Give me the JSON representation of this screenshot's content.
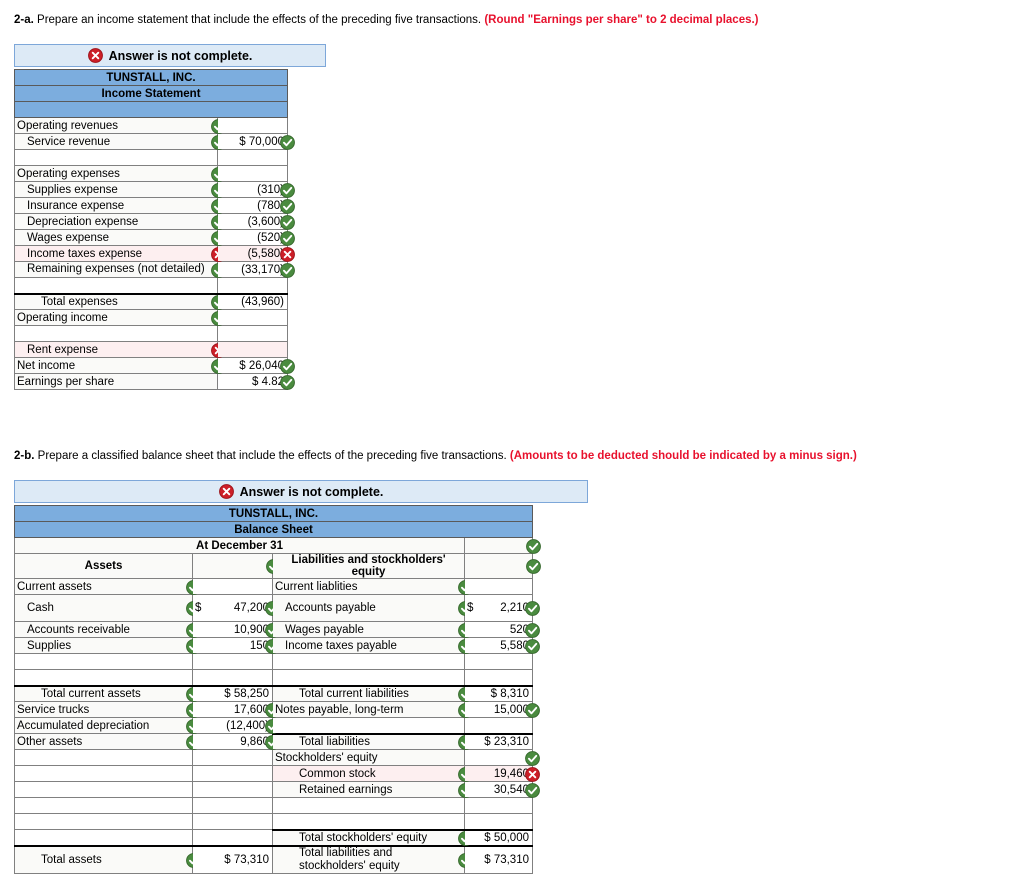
{
  "q2a": {
    "number": "2-a.",
    "text": "Prepare an income statement that include the effects of the preceding five transactions.",
    "hint": "(Round \"Earnings per share\" to 2 decimal places.)",
    "banner": "Answer is not complete.",
    "banner_icon": "x-circle-icon",
    "title1": "TUNSTALL, INC.",
    "title2": "Income Statement",
    "rows": [
      {
        "label": "Operating revenues",
        "indent": 0,
        "label_mark": "check",
        "value": "",
        "value_mark": "",
        "state": "ok"
      },
      {
        "label": "Service revenue",
        "indent": 1,
        "label_mark": "check",
        "value": "$ 70,000",
        "value_mark": "check",
        "state": "ok",
        "dollar": true
      },
      {
        "label": "",
        "indent": 0,
        "label_mark": "",
        "value": "",
        "value_mark": "",
        "state": "blank"
      },
      {
        "label": "Operating expenses",
        "indent": 0,
        "label_mark": "check",
        "value": "",
        "value_mark": "",
        "state": "ok"
      },
      {
        "label": "Supplies expense",
        "indent": 1,
        "label_mark": "check",
        "value": "(310)",
        "value_mark": "check",
        "state": "ok"
      },
      {
        "label": "Insurance expense",
        "indent": 1,
        "label_mark": "check",
        "value": "(780)",
        "value_mark": "check",
        "state": "ok"
      },
      {
        "label": "Depreciation expense",
        "indent": 1,
        "label_mark": "check",
        "value": "(3,600)",
        "value_mark": "check",
        "state": "ok"
      },
      {
        "label": "Wages expense",
        "indent": 1,
        "label_mark": "check",
        "value": "(520)",
        "value_mark": "check",
        "state": "ok"
      },
      {
        "label": "Income taxes expense",
        "indent": 1,
        "label_mark": "x",
        "value": "(5,580)",
        "value_mark": "x",
        "state": "err"
      },
      {
        "label": "Remaining expenses (not detailed)",
        "indent": 1,
        "label_mark": "check",
        "value": "(33,170)",
        "value_mark": "check",
        "state": "ok",
        "wrap": true
      },
      {
        "label": "",
        "indent": 0,
        "label_mark": "",
        "value": "",
        "value_mark": "",
        "state": "blank"
      },
      {
        "label": "Total expenses",
        "indent": 2,
        "label_mark": "check",
        "value": "(43,960)",
        "value_mark": "",
        "state": "ok",
        "topline": true
      },
      {
        "label": "Operating income",
        "indent": 0,
        "label_mark": "check",
        "value": "",
        "value_mark": "",
        "state": "ok"
      },
      {
        "label": "",
        "indent": 0,
        "label_mark": "",
        "value": "",
        "value_mark": "",
        "state": "blank"
      },
      {
        "label": "Rent expense",
        "indent": 1,
        "label_mark": "x",
        "value": "",
        "value_mark": "",
        "state": "err"
      },
      {
        "label": "Net income",
        "indent": 0,
        "label_mark": "check",
        "value": "$ 26,040",
        "value_mark": "check",
        "state": "ok",
        "dollar": true
      },
      {
        "label": "Earnings per share",
        "indent": 0,
        "label_mark": "",
        "value": "$     4.82",
        "value_mark": "check",
        "state": "ok",
        "dollar": true
      }
    ]
  },
  "q2b": {
    "number": "2-b.",
    "text": "Prepare a classified balance sheet that include the effects of the preceding five transactions.",
    "hint": "(Amounts to be deducted should be indicated by a minus sign.)",
    "banner": "Answer is not complete.",
    "banner_icon": "x-circle-icon",
    "title1": "TUNSTALL, INC.",
    "title2": "Balance Sheet",
    "title3": "At December 31",
    "title3_mark": "check",
    "col_head_left": "Assets",
    "col_head_left_mark": "check",
    "col_head_right": "Liabilities and stockholders' equity",
    "col_head_right_mark": "check",
    "rows": [
      {
        "left": {
          "label": "Current assets",
          "indent": 0,
          "mark": "check",
          "value": "",
          "vmark": "",
          "state": "ok"
        },
        "right": {
          "label": "Current liablities",
          "indent": 0,
          "mark": "check",
          "value": "",
          "vmark": "",
          "state": "ok"
        }
      },
      {
        "left": {
          "label": "Cash",
          "indent": 1,
          "mark": "check",
          "value": "47,200",
          "dollar": "$",
          "vmark": "check",
          "state": "ok",
          "tall": true
        },
        "right": {
          "label": "Accounts payable",
          "indent": 1,
          "mark": "check",
          "value": "2,210",
          "dollar": "$",
          "vmark": "check",
          "state": "ok",
          "tall": true
        }
      },
      {
        "left": {
          "label": "Accounts receivable",
          "indent": 1,
          "mark": "check",
          "value": "10,900",
          "vmark": "check",
          "state": "ok"
        },
        "right": {
          "label": "Wages payable",
          "indent": 1,
          "mark": "check",
          "value": "520",
          "vmark": "check",
          "state": "ok"
        }
      },
      {
        "left": {
          "label": "Supplies",
          "indent": 1,
          "mark": "check",
          "value": "150",
          "vmark": "check",
          "state": "ok"
        },
        "right": {
          "label": "Income taxes payable",
          "indent": 1,
          "mark": "check",
          "value": "5,580",
          "vmark": "check",
          "state": "ok"
        }
      },
      {
        "left": {
          "label": "",
          "indent": 0,
          "mark": "",
          "value": "",
          "vmark": "",
          "state": "blank"
        },
        "right": {
          "label": "",
          "indent": 0,
          "mark": "",
          "value": "",
          "vmark": "",
          "state": "blank"
        }
      },
      {
        "left": {
          "label": "",
          "indent": 0,
          "mark": "",
          "value": "",
          "vmark": "",
          "state": "blank"
        },
        "right": {
          "label": "",
          "indent": 0,
          "mark": "",
          "value": "",
          "vmark": "",
          "state": "blank"
        }
      },
      {
        "left": {
          "label": "Total current assets",
          "indent": 2,
          "mark": "check",
          "value": "$   58,250",
          "vmark": "",
          "state": "ok",
          "topline": true
        },
        "right": {
          "label": "Total current liabilities",
          "indent": 2,
          "mark": "check",
          "value": "$   8,310",
          "vmark": "",
          "state": "ok",
          "topline": true
        }
      },
      {
        "left": {
          "label": "Service trucks",
          "indent": 0,
          "mark": "check",
          "value": "17,600",
          "vmark": "check",
          "state": "ok"
        },
        "right": {
          "label": "Notes payable, long-term",
          "indent": 0,
          "mark": "check",
          "value": "15,000",
          "vmark": "check",
          "state": "ok"
        }
      },
      {
        "left": {
          "label": "Accumulated depreciation",
          "indent": 0,
          "mark": "check",
          "value": "(12,400)",
          "vmark": "check",
          "state": "ok"
        },
        "right": {
          "label": "",
          "indent": 0,
          "mark": "",
          "value": "",
          "vmark": "",
          "state": "blank"
        }
      },
      {
        "left": {
          "label": "Other assets",
          "indent": 0,
          "mark": "check",
          "value": "9,860",
          "vmark": "check",
          "state": "ok"
        },
        "right": {
          "label": "Total liabilities",
          "indent": 2,
          "mark": "check",
          "value": "$ 23,310",
          "vmark": "",
          "state": "ok",
          "topline": true
        }
      },
      {
        "left": {
          "label": "",
          "indent": 0,
          "mark": "",
          "value": "",
          "vmark": "",
          "state": "blank"
        },
        "right": {
          "label": "Stockholders' equity",
          "indent": 0,
          "mark": "",
          "value": "",
          "vmark": "check",
          "state": "ok"
        }
      },
      {
        "left": {
          "label": "",
          "indent": 0,
          "mark": "",
          "value": "",
          "vmark": "",
          "state": "blank"
        },
        "right": {
          "label": "Common stock",
          "indent": 2,
          "mark": "check",
          "value": "19,460",
          "vmark": "x",
          "state": "err"
        }
      },
      {
        "left": {
          "label": "",
          "indent": 0,
          "mark": "",
          "value": "",
          "vmark": "",
          "state": "blank"
        },
        "right": {
          "label": "Retained earnings",
          "indent": 2,
          "mark": "check",
          "value": "30,540",
          "vmark": "check",
          "state": "ok"
        }
      },
      {
        "left": {
          "label": "",
          "indent": 0,
          "mark": "",
          "value": "",
          "vmark": "",
          "state": "blank"
        },
        "right": {
          "label": "",
          "indent": 0,
          "mark": "",
          "value": "",
          "vmark": "",
          "state": "blank"
        }
      },
      {
        "left": {
          "label": "",
          "indent": 0,
          "mark": "",
          "value": "",
          "vmark": "",
          "state": "blank"
        },
        "right": {
          "label": "",
          "indent": 0,
          "mark": "",
          "value": "",
          "vmark": "",
          "state": "blank"
        }
      },
      {
        "left": {
          "label": "",
          "indent": 0,
          "mark": "",
          "value": "",
          "vmark": "",
          "state": "blank"
        },
        "right": {
          "label": "Total stockholders' equity",
          "indent": 2,
          "mark": "check",
          "value": "$ 50,000",
          "vmark": "",
          "state": "ok",
          "topline": true
        }
      },
      {
        "left": {
          "label": "Total assets",
          "indent": 2,
          "mark": "check",
          "value": "$   73,310",
          "vmark": "",
          "state": "ok",
          "topline": true,
          "tall": true
        },
        "right": {
          "label": "Total liabilities and stockholders' equity",
          "indent": 2,
          "mark": "check",
          "value": "$ 73,310",
          "vmark": "",
          "state": "ok",
          "topline": true,
          "tall": true,
          "wrap": true
        }
      }
    ]
  },
  "colors": {
    "header_blue": "#7cadde",
    "banner_blue": "#ddeaf6",
    "banner_border": "#7da7d9",
    "hint_red": "#e8112d",
    "check_green": "#4a8b3f",
    "error_red": "#cc1f28",
    "error_row_bg": "#fdeff0",
    "grid": "#808080"
  }
}
